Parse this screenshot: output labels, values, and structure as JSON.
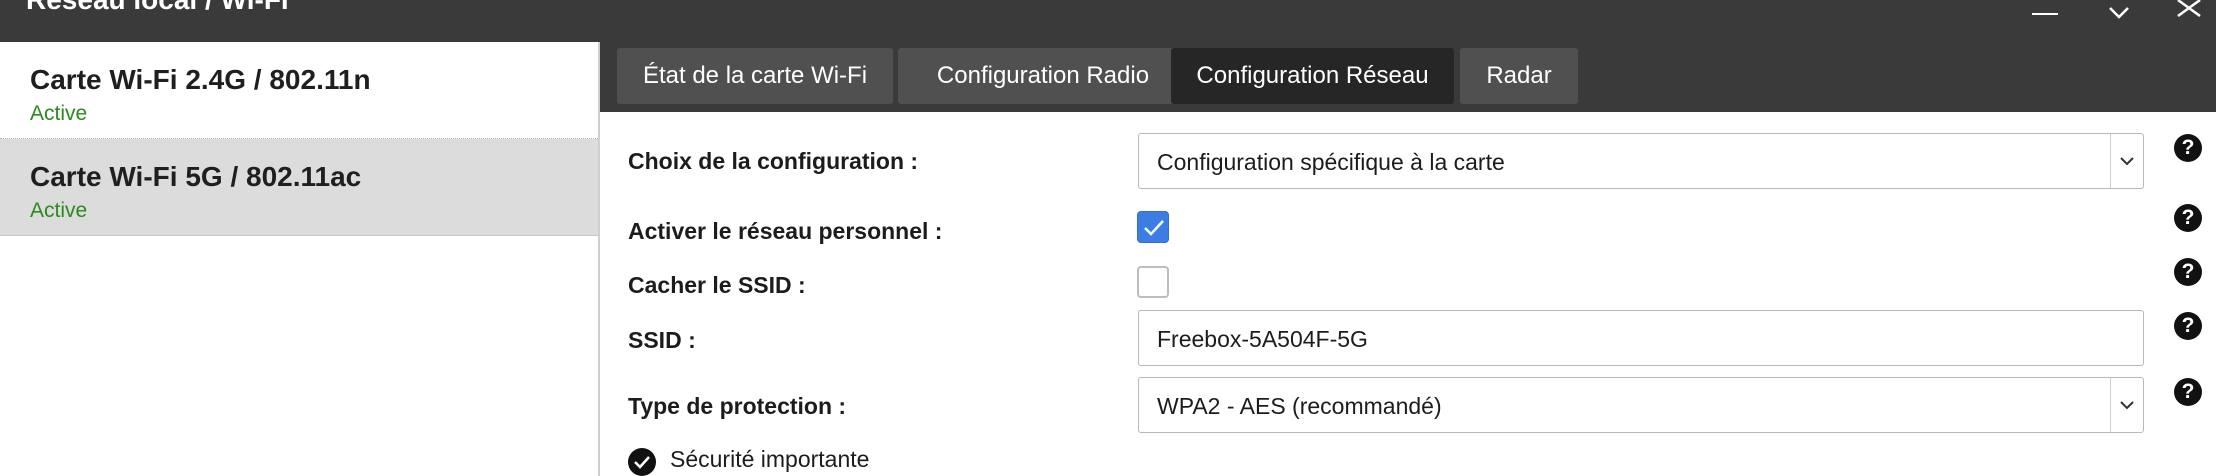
{
  "window": {
    "title": "Réseau local / Wi-Fi",
    "controls": [
      "minimize-icon",
      "chevron-down-icon",
      "close-icon"
    ]
  },
  "sidebar": {
    "cards": [
      {
        "name": "Carte Wi-Fi 2.4G / 802.11n",
        "status": "Active",
        "selected": false
      },
      {
        "name": "Carte Wi-Fi 5G / 802.11ac",
        "status": "Active",
        "selected": true
      }
    ]
  },
  "tabs": [
    {
      "label": "État de la carte Wi-Fi",
      "active": false
    },
    {
      "label": "Configuration Radio",
      "active": false
    },
    {
      "label": "Configuration Réseau",
      "active": true
    },
    {
      "label": "Radar",
      "active": false
    }
  ],
  "form": {
    "config_choice": {
      "label": "Choix de la configuration :",
      "value": "Configuration spécifique à la carte"
    },
    "personal_network": {
      "label": "Activer le réseau personnel :",
      "checked": true
    },
    "hide_ssid": {
      "label": "Cacher le SSID :",
      "checked": false
    },
    "ssid": {
      "label": "SSID :",
      "value": "Freebox-5A504F-5G"
    },
    "protection": {
      "label": "Type de protection :",
      "value": "WPA2 - AES (recommandé)"
    },
    "security_note": "Sécurité importante",
    "help_glyph": "?"
  },
  "colors": {
    "titlebar": "#3a3a3a",
    "active_tab": "#262626",
    "inactive_tab": "#505050",
    "status_active": "#2a8a1c",
    "checkbox_checked": "#3b7de3",
    "selected_card": "#dcdcdc"
  }
}
